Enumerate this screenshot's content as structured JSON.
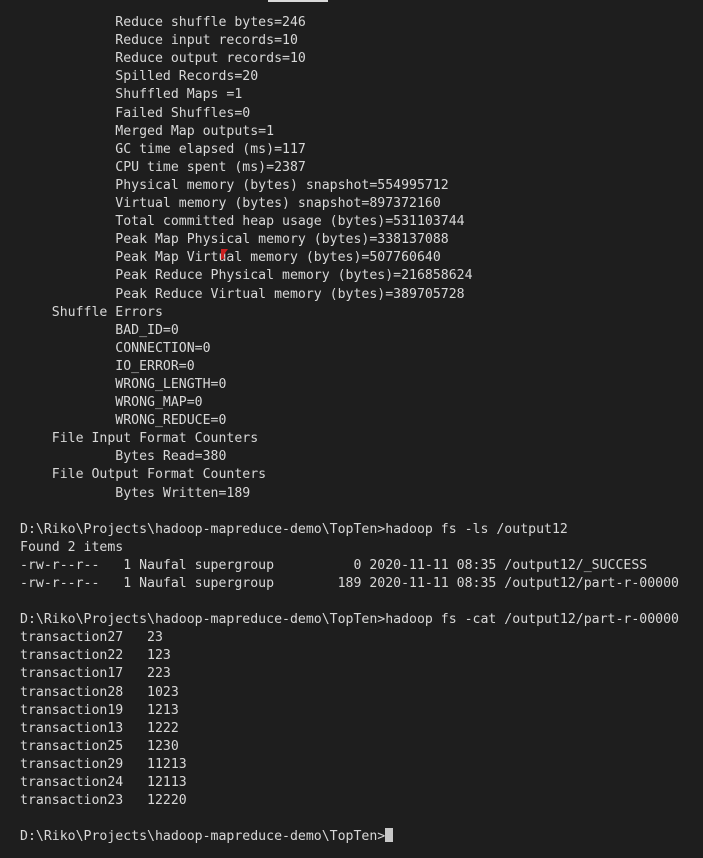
{
  "terminal": {
    "window_kind": "windows-command-prompt",
    "background_color": "#1e1e1e",
    "foreground_color": "#d8d8d8",
    "cursor_color": "#c8c8c8",
    "pointer_color": "#cc1f1f",
    "cursor_glyph": " ",
    "lines": [
      "",
      "            Reduce shuffle bytes=246",
      "            Reduce input records=10",
      "            Reduce output records=10",
      "            Spilled Records=20",
      "            Shuffled Maps =1",
      "            Failed Shuffles=0",
      "            Merged Map outputs=1",
      "            GC time elapsed (ms)=117",
      "            CPU time spent (ms)=2387",
      "            Physical memory (bytes) snapshot=554995712",
      "            Virtual memory (bytes) snapshot=897372160",
      "            Total committed heap usage (bytes)=531103744",
      "            Peak Map Physical memory (bytes)=338137088",
      "            Peak Map Virtual memory (bytes)=507760640",
      "            Peak Reduce Physical memory (bytes)=216858624",
      "            Peak Reduce Virtual memory (bytes)=389705728",
      "    Shuffle Errors",
      "            BAD_ID=0",
      "            CONNECTION=0",
      "            IO_ERROR=0",
      "            WRONG_LENGTH=0",
      "            WRONG_MAP=0",
      "            WRONG_REDUCE=0",
      "    File Input Format Counters",
      "            Bytes Read=380",
      "    File Output Format Counters",
      "            Bytes Written=189",
      "",
      "D:\\Riko\\Projects\\hadoop-mapreduce-demo\\TopTen>hadoop fs -ls /output12",
      "Found 2 items",
      "-rw-r--r--   1 Naufal supergroup          0 2020-11-11 08:35 /output12/_SUCCESS",
      "-rw-r--r--   1 Naufal supergroup        189 2020-11-11 08:35 /output12/part-r-00000",
      "",
      "D:\\Riko\\Projects\\hadoop-mapreduce-demo\\TopTen>hadoop fs -cat /output12/part-r-00000",
      "transaction27   23",
      "transaction22   123",
      "transaction17   223",
      "transaction28   1023",
      "transaction19   1213",
      "transaction13   1222",
      "transaction25   1230",
      "transaction29   11213",
      "transaction24   12113",
      "transaction23   12220",
      "",
      "D:\\Riko\\Projects\\hadoop-mapreduce-demo\\TopTen>"
    ],
    "prompt": "D:\\Riko\\Projects\\hadoop-mapreduce-demo\\TopTen>",
    "commands": [
      "hadoop fs -ls /output12",
      "hadoop fs -cat /output12/part-r-00000"
    ],
    "counters": {
      "map_reduce_framework": [
        {
          "label": "Reduce shuffle bytes",
          "value": "246"
        },
        {
          "label": "Reduce input records",
          "value": "10"
        },
        {
          "label": "Reduce output records",
          "value": "10"
        },
        {
          "label": "Spilled Records",
          "value": "20"
        },
        {
          "label": "Shuffled Maps ",
          "value": "1"
        },
        {
          "label": "Failed Shuffles",
          "value": "0"
        },
        {
          "label": "Merged Map outputs",
          "value": "1"
        },
        {
          "label": "GC time elapsed (ms)",
          "value": "117"
        },
        {
          "label": "CPU time spent (ms)",
          "value": "2387"
        },
        {
          "label": "Physical memory (bytes) snapshot",
          "value": "554995712"
        },
        {
          "label": "Virtual memory (bytes) snapshot",
          "value": "897372160"
        },
        {
          "label": "Total committed heap usage (bytes)",
          "value": "531103744"
        },
        {
          "label": "Peak Map Physical memory (bytes)",
          "value": "338137088"
        },
        {
          "label": "Peak Map Virtual memory (bytes)",
          "value": "507760640"
        },
        {
          "label": "Peak Reduce Physical memory (bytes)",
          "value": "216858624"
        },
        {
          "label": "Peak Reduce Virtual memory (bytes)",
          "value": "389705728"
        }
      ],
      "shuffle_errors_header": "Shuffle Errors",
      "shuffle_errors": [
        {
          "label": "BAD_ID",
          "value": "0"
        },
        {
          "label": "CONNECTION",
          "value": "0"
        },
        {
          "label": "IO_ERROR",
          "value": "0"
        },
        {
          "label": "WRONG_LENGTH",
          "value": "0"
        },
        {
          "label": "WRONG_MAP",
          "value": "0"
        },
        {
          "label": "WRONG_REDUCE",
          "value": "0"
        }
      ],
      "file_input_header": "File Input Format Counters",
      "file_input": [
        {
          "label": "Bytes Read",
          "value": "380"
        }
      ],
      "file_output_header": "File Output Format Counters",
      "file_output": [
        {
          "label": "Bytes Written",
          "value": "189"
        }
      ]
    },
    "ls_output": {
      "found_line": "Found 2 items",
      "rows": [
        {
          "perms": "-rw-r--r--",
          "replication": "1",
          "owner": "Naufal",
          "group": "supergroup",
          "size": "0",
          "date": "2020-11-11",
          "time": "08:35",
          "path": "/output12/_SUCCESS"
        },
        {
          "perms": "-rw-r--r--",
          "replication": "1",
          "owner": "Naufal",
          "group": "supergroup",
          "size": "189",
          "date": "2020-11-11",
          "time": "08:35",
          "path": "/output12/part-r-00000"
        }
      ]
    },
    "cat_output": {
      "rows": [
        {
          "key": "transaction27",
          "value": "23"
        },
        {
          "key": "transaction22",
          "value": "123"
        },
        {
          "key": "transaction17",
          "value": "223"
        },
        {
          "key": "transaction28",
          "value": "1023"
        },
        {
          "key": "transaction19",
          "value": "1213"
        },
        {
          "key": "transaction13",
          "value": "1222"
        },
        {
          "key": "transaction25",
          "value": "1230"
        },
        {
          "key": "transaction29",
          "value": "11213"
        },
        {
          "key": "transaction24",
          "value": "12113"
        },
        {
          "key": "transaction23",
          "value": "12220"
        }
      ]
    }
  }
}
